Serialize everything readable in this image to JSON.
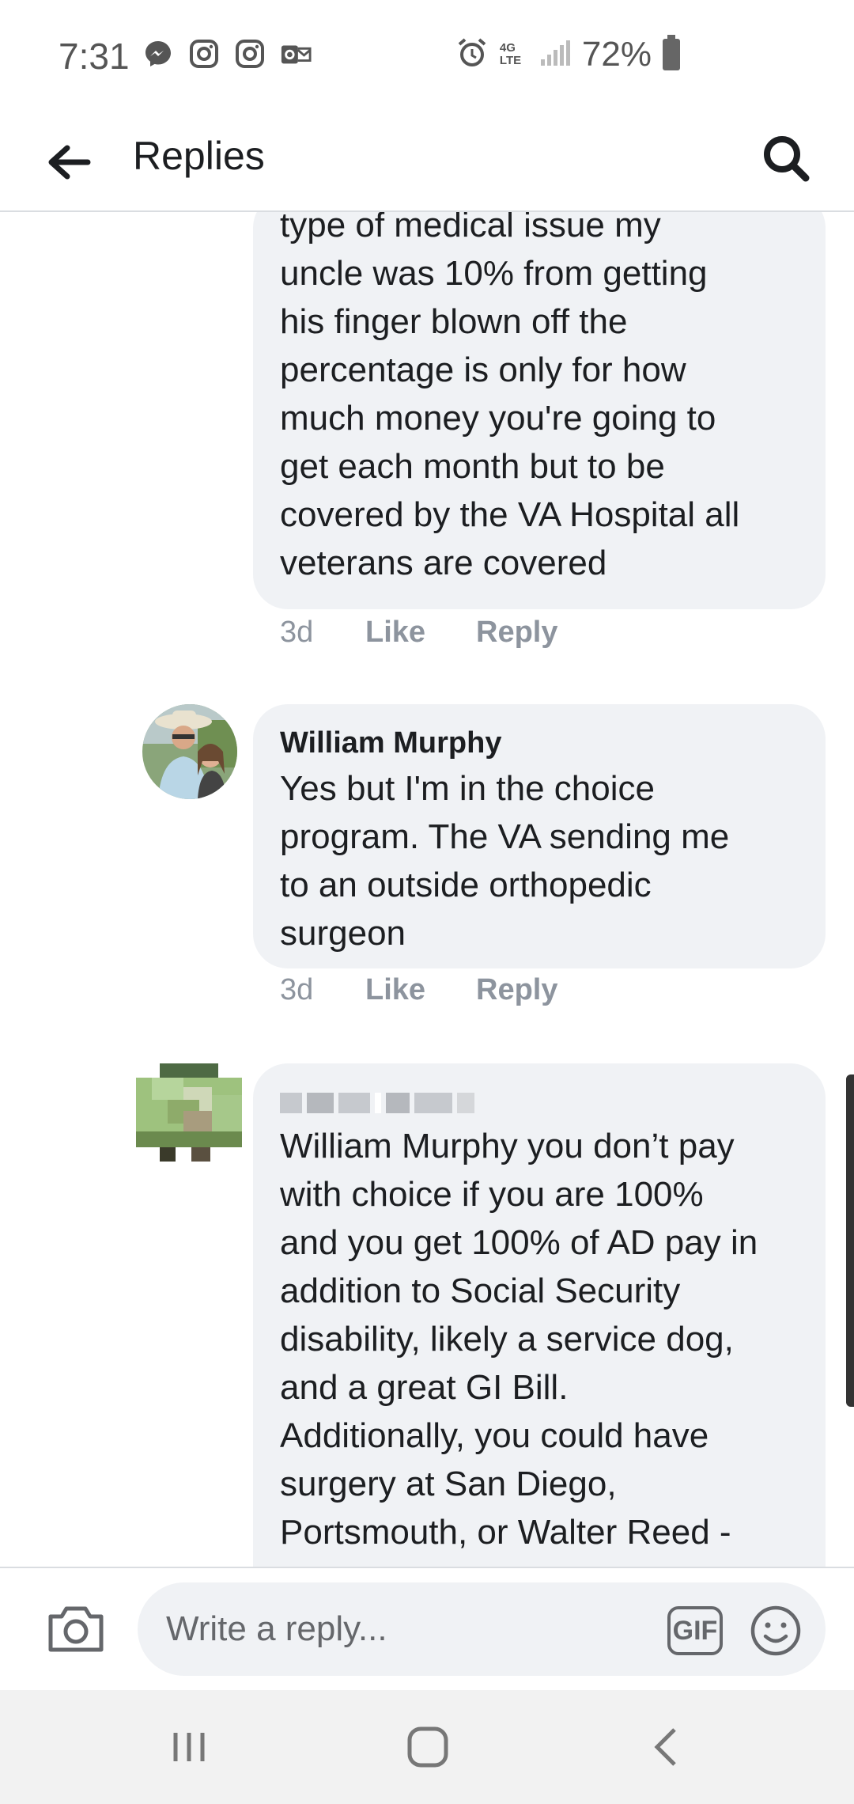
{
  "status_bar": {
    "time": "7:31",
    "left_icons": [
      "messenger-icon",
      "instagram-icon",
      "instagram-icon",
      "outlook-icon"
    ],
    "network": "4G LTE",
    "battery": "72%"
  },
  "header": {
    "title": "Replies"
  },
  "comments": [
    {
      "text": "type of medical issue my\nuncle was 10% from getting\nhis finger blown off the\npercentage is only for how\nmuch money you're going to\nget each month but to be\ncovered by the VA Hospital all\nveterans are covered",
      "time": "3d",
      "like": "Like",
      "reply": "Reply"
    },
    {
      "author": "William Murphy",
      "text": "Yes but I'm in the choice\nprogram. The VA sending me\nto an outside orthopedic\nsurgeon",
      "time": "3d",
      "like": "Like",
      "reply": "Reply"
    },
    {
      "author": "",
      "text": "William Murphy you don’t pay\nwith choice if you are 100%\nand you get 100% of AD pay in\naddition to Social Security\ndisability, likely a service dog,\nand a great GI Bill.\nAdditionally, you could have\nsurgery at San Diego,\nPortsmouth, or Walter Reed  -"
    }
  ],
  "reply_bar": {
    "placeholder": "Write a reply...",
    "gif_label": "GIF"
  },
  "colors": {
    "bubble": "#f0f2f5",
    "action_text": "#8d949e",
    "divider": "#dadde1"
  }
}
